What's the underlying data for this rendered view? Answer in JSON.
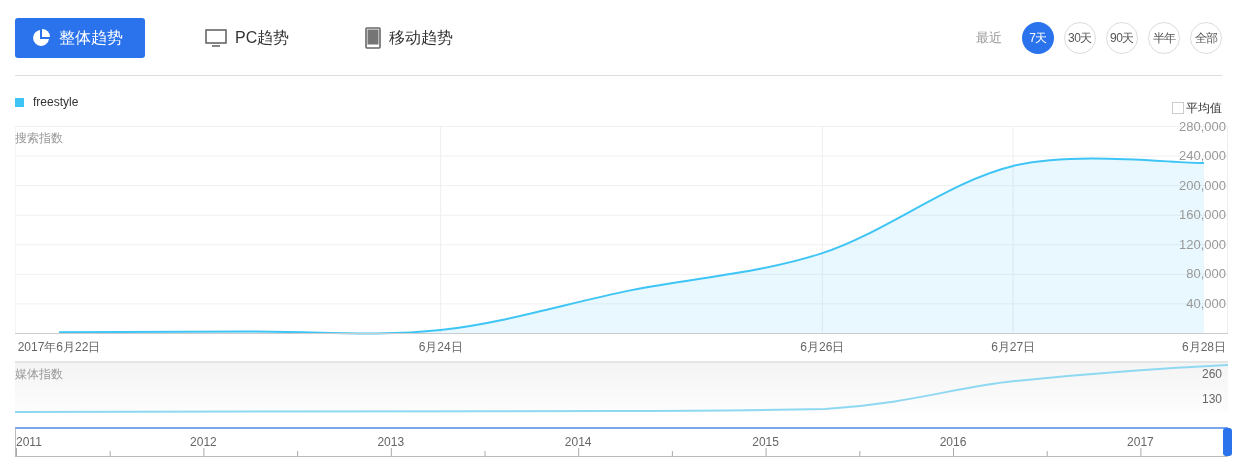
{
  "tabs": [
    {
      "label": "整体趋势",
      "kind": "pie",
      "selected": true
    },
    {
      "label": "PC趋势",
      "kind": "monitor",
      "selected": false
    },
    {
      "label": "移动趋势",
      "kind": "tablet",
      "selected": false
    }
  ],
  "range": {
    "label": "最近",
    "options": [
      {
        "label": "7天",
        "selected": true
      },
      {
        "label": "30天",
        "selected": false
      },
      {
        "label": "90天",
        "selected": false
      },
      {
        "label": "半年",
        "selected": false
      },
      {
        "label": "全部",
        "selected": false
      }
    ]
  },
  "average": {
    "label": "平均值",
    "checked": false
  },
  "search_chart": {
    "label": "搜索指数",
    "chart_data": {
      "type": "area",
      "categories": [
        "2017年6月22日",
        null,
        "6月24日",
        null,
        "6月26日",
        "6月27日",
        "6月28日"
      ],
      "series": [
        {
          "name": "freestyle",
          "color": "#3ec5f5",
          "values": [
            1000,
            2000,
            4000,
            58000,
            108000,
            226000,
            230000
          ]
        }
      ],
      "ylim": [
        0,
        280000
      ],
      "grid": true,
      "yticks": [
        {
          "value": 40000,
          "label": "40,000"
        },
        {
          "value": 80000,
          "label": "80,000"
        },
        {
          "value": 120000,
          "label": "120,000"
        },
        {
          "value": 160000,
          "label": "160,000"
        },
        {
          "value": 200000,
          "label": "200,000"
        },
        {
          "value": 240000,
          "label": "240,000"
        },
        {
          "value": 280000,
          "label": "280,000"
        }
      ]
    }
  },
  "media_chart": {
    "label": "媒体指数",
    "axis_labels": [
      "260",
      "130"
    ]
  },
  "navigator": {
    "years": [
      "2011",
      "2012",
      "2013",
      "2014",
      "2015",
      "2016",
      "2017"
    ]
  }
}
